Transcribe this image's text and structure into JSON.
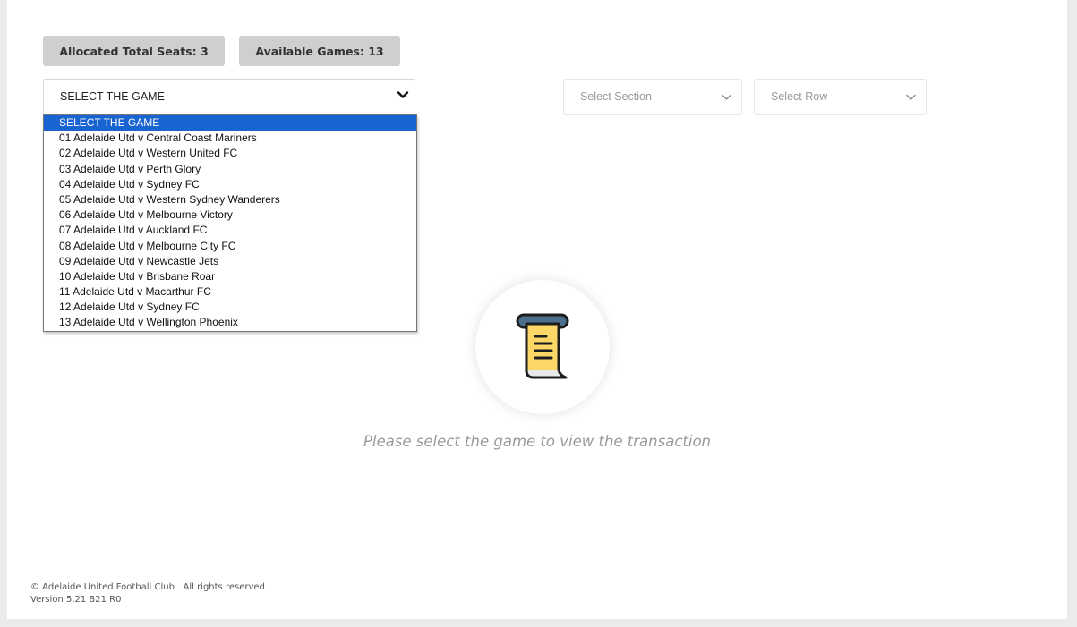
{
  "badges": {
    "allocated": "Allocated Total Seats: 3",
    "available": "Available Games: 13"
  },
  "game_select": {
    "value": "SELECT THE GAME",
    "options": [
      "SELECT THE GAME",
      "01 Adelaide Utd v Central Coast Mariners",
      "02 Adelaide Utd v Western United FC",
      "03 Adelaide Utd v Perth Glory",
      "04 Adelaide Utd v Sydney FC",
      "05 Adelaide Utd v Western Sydney Wanderers",
      "06 Adelaide Utd v Melbourne Victory",
      "07 Adelaide Utd v Auckland FC",
      "08 Adelaide Utd v Melbourne City FC",
      "09 Adelaide Utd v Newcastle Jets",
      "10 Adelaide Utd v Brisbane Roar",
      "11 Adelaide Utd v Macarthur FC",
      "12 Adelaide Utd v Sydney FC",
      "13 Adelaide Utd v Wellington Phoenix"
    ],
    "highlighted_index": 0
  },
  "section_select": {
    "placeholder": "Select Section"
  },
  "row_select": {
    "placeholder": "Select Row"
  },
  "empty_state": {
    "icon": "receipt-scroll-icon",
    "message": "Please select the game to view the transaction"
  },
  "footer": {
    "copyright": "© Adelaide United Football Club . All rights reserved.",
    "version": "Version 5.21 B21 R0"
  },
  "colors": {
    "highlight": "#1a64d2",
    "badge_bg": "#cfcfcf",
    "page_bg": "#ebebeb",
    "icon_yellow": "#fcd667",
    "icon_blue": "#4a6e8c"
  }
}
